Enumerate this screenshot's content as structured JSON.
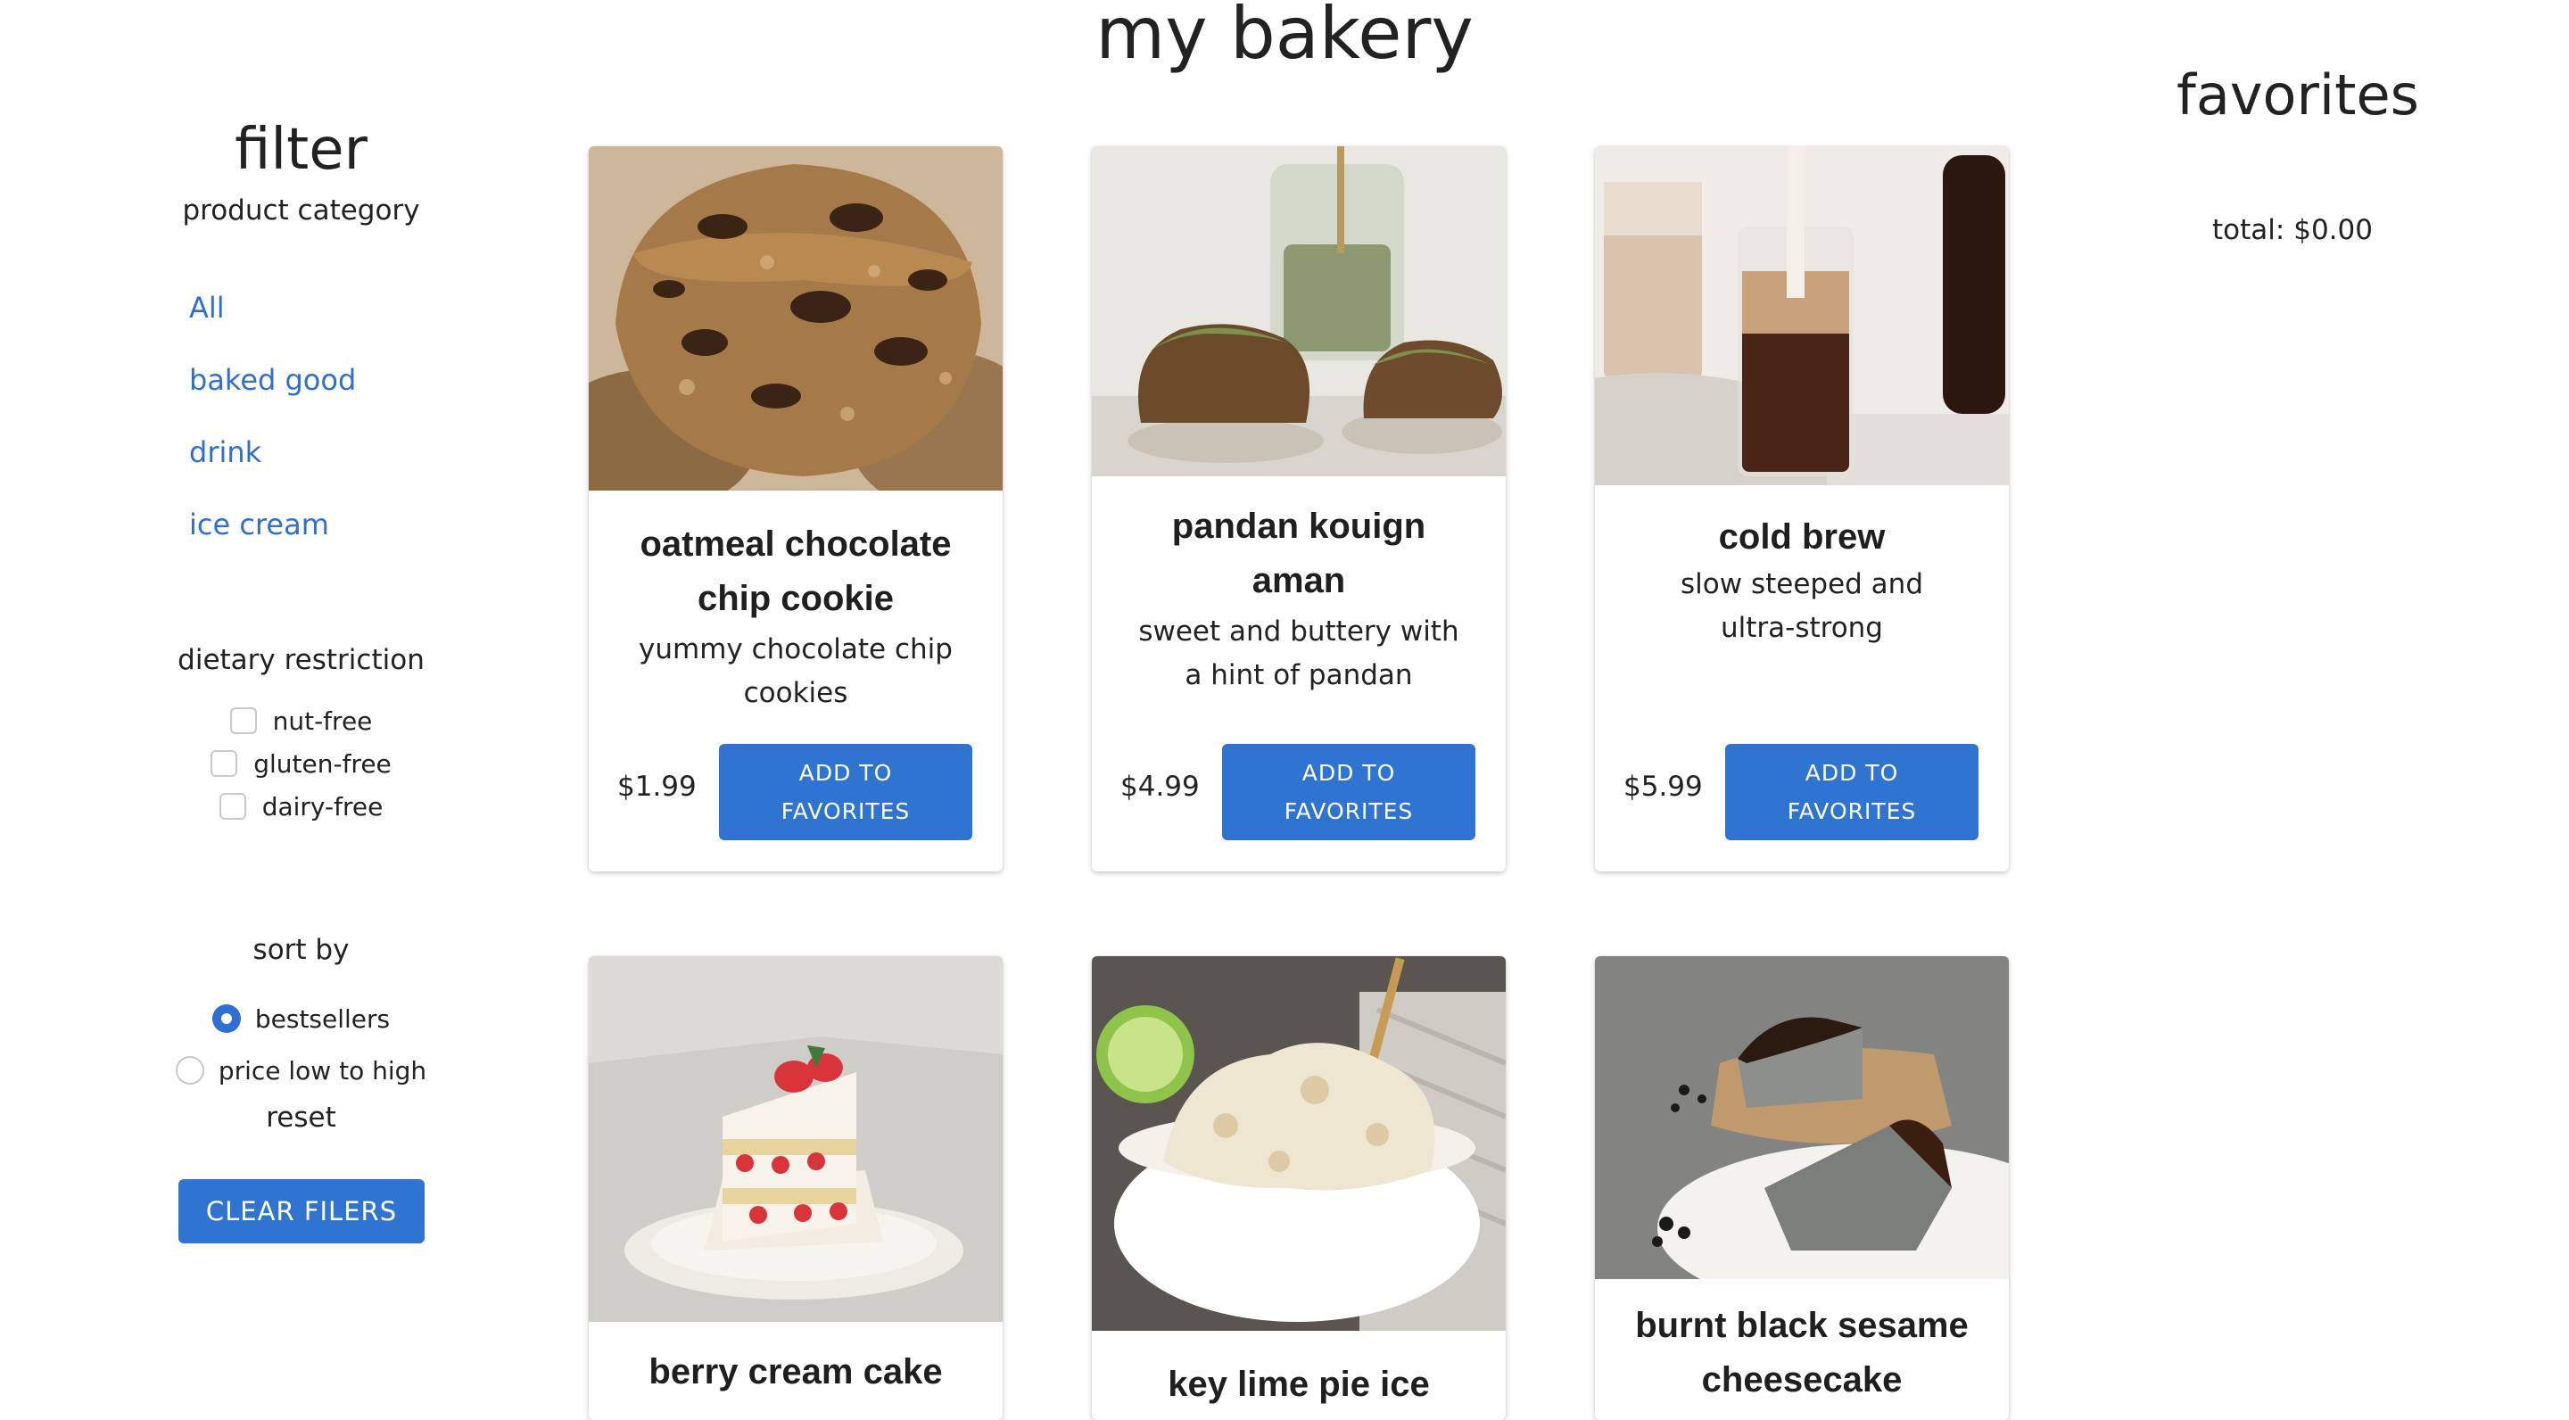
{
  "page": {
    "title": "my bakery"
  },
  "filter": {
    "heading": "filter",
    "category_label": "product category",
    "categories": [
      "All",
      "baked good",
      "drink",
      "ice cream"
    ],
    "dietary_label": "dietary restriction",
    "dietary_options": [
      "nut-free",
      "gluten-free",
      "dairy-free"
    ],
    "sort_label": "sort by",
    "sort_options": [
      {
        "label": "bestsellers",
        "selected": true
      },
      {
        "label": "price low to high",
        "selected": false
      }
    ],
    "reset_label": "reset",
    "clear_button": "CLEAR FILERS"
  },
  "products": [
    {
      "name": "oatmeal chocolate chip cookie",
      "description": "yummy chocolate chip cookies",
      "price": "$1.99",
      "button": "ADD TO\nFAVORITES"
    },
    {
      "name": "pandan kouign aman",
      "description": "sweet and buttery with a hint of pandan",
      "price": "$4.99",
      "button": "ADD TO\nFAVORITES"
    },
    {
      "name": "cold brew",
      "description": "slow steeped and ultra-strong",
      "price": "$5.99",
      "button": "ADD TO\nFAVORITES"
    },
    {
      "name": "berry cream cake"
    },
    {
      "name": "key lime pie ice"
    },
    {
      "name": "burnt black sesame cheesecake"
    }
  ],
  "favorites": {
    "heading": "favorites",
    "total": "total: $0.00"
  },
  "colors": {
    "accent": "#2f74d0",
    "link": "#2f6fd3"
  }
}
